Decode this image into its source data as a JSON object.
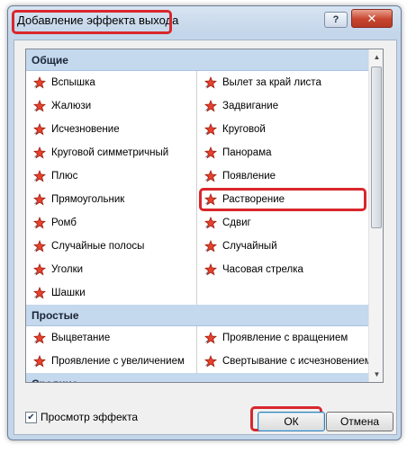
{
  "window": {
    "title": "Добавление эффекта выхода",
    "help_label": "?",
    "close_label": "✕"
  },
  "groups": [
    {
      "header": "Общие",
      "left": [
        "Вспышка",
        "Жалюзи",
        "Исчезновение",
        "Круговой симметричный",
        "Плюс",
        "Прямоугольник",
        "Ромб",
        "Случайные полосы",
        "Уголки",
        "Шашки"
      ],
      "right": [
        "Вылет за край листа",
        "Задвигание",
        "Круговой",
        "Панорама",
        "Появление",
        "Растворение",
        "Сдвиг",
        "Случайный",
        "Часовая стрелка"
      ],
      "highlighted": "Растворение"
    },
    {
      "header": "Простые",
      "left": [
        "Выцветание",
        "Проявление с увеличением"
      ],
      "right": [
        "Проявление с вращением",
        "Свертывание с исчезновением"
      ]
    },
    {
      "header": "Средние",
      "left": [],
      "right": []
    }
  ],
  "footer": {
    "preview_checked": true,
    "preview_label": "Просмотр эффекта",
    "ok_label": "ОК",
    "cancel_label": "Отмена"
  },
  "colors": {
    "star_fill": "#e8412c",
    "star_stroke": "#9a1e10",
    "highlight": "#d9262c"
  },
  "icons": {
    "effect": "exit-effect-star-icon",
    "scroll_up": "scroll-up-arrow-icon",
    "scroll_down": "scroll-down-arrow-icon"
  }
}
